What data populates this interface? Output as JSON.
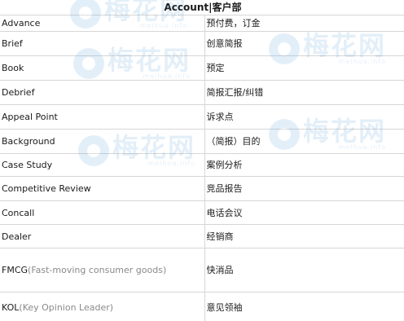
{
  "header": {
    "title": "Account|客户部"
  },
  "rows": [
    {
      "term": "Advance",
      "note": "",
      "translation": "预付费，订金"
    },
    {
      "term": "Brief",
      "note": "",
      "translation": "创意简报"
    },
    {
      "term": "Book",
      "note": "",
      "translation": "预定"
    },
    {
      "term": "Debrief",
      "note": "",
      "translation": "简报汇报/纠错"
    },
    {
      "term": "Appeal Point",
      "note": "",
      "translation": "诉求点"
    },
    {
      "term": "Background",
      "note": "",
      "translation": "（简报）目的"
    },
    {
      "term": "Case Study",
      "note": "",
      "translation": "案例分析"
    },
    {
      "term": "Competitive Review",
      "note": "",
      "translation": "竞品报告"
    },
    {
      "term": "Concall",
      "note": "",
      "translation": "电话会议"
    },
    {
      "term": "Dealer",
      "note": "",
      "translation": "经销商"
    },
    {
      "term": "FMCG",
      "note": "(Fast-moving consumer goods)",
      "translation": "快消品"
    },
    {
      "term": "KOL",
      "note": "(Key Opinion Leader)",
      "translation": "意见领袖"
    }
  ],
  "watermark": {
    "cn": "梅花网",
    "en": "meihua.info"
  },
  "colors": {
    "text": "#1a1a1a",
    "note": "#8a8a8a",
    "grid": "#d6d6d6",
    "watermark": "#5aa0d8"
  }
}
